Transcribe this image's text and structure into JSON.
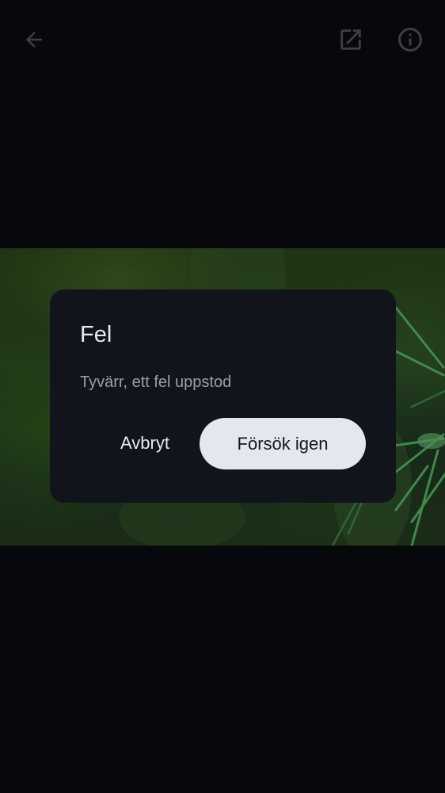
{
  "dialog": {
    "title": "Fel",
    "message": "Tyvärr, ett fel uppstod",
    "cancel_label": "Avbryt",
    "retry_label": "Försök igen"
  },
  "toolbar": {
    "back_icon": "arrow-left-icon",
    "open_icon": "open-in-new-icon",
    "info_icon": "info-icon"
  },
  "colors": {
    "background": "#06080b",
    "dialog_surface": "#11141a",
    "primary_button": "#e4e7ee",
    "icon_dim": "#3c3f44"
  }
}
